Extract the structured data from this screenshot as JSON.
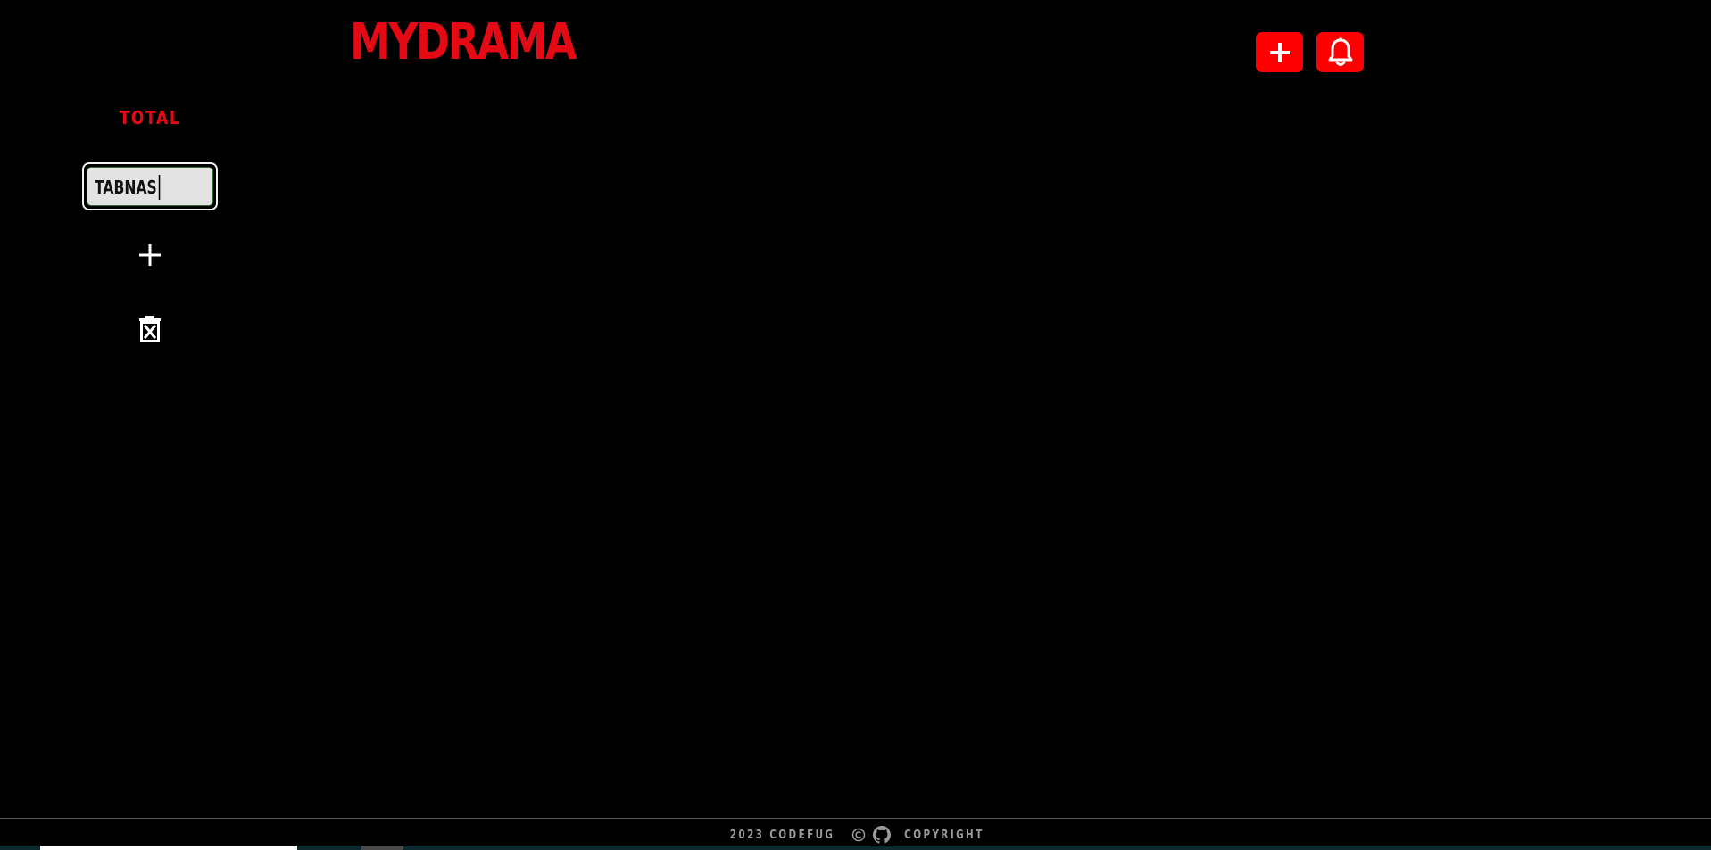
{
  "app": {
    "logo_text": "MYDRAMA",
    "brand_color": "#e50914",
    "accent_button_color": "#ff0000"
  },
  "header": {
    "add_button_icon": "plus-icon",
    "notifications_button_icon": "bell-icon"
  },
  "sidebar": {
    "title": "TOTAL",
    "tab_input": {
      "value": "TABNAS"
    },
    "add_tab_icon": "plus-icon",
    "delete_tab_icon": "trash-x-icon"
  },
  "footer": {
    "year_author": "2023 CODEFUG",
    "copyright_icon": "copyright-icon",
    "github_icon": "github-icon",
    "copyright_text": "COPYRIGHT"
  }
}
